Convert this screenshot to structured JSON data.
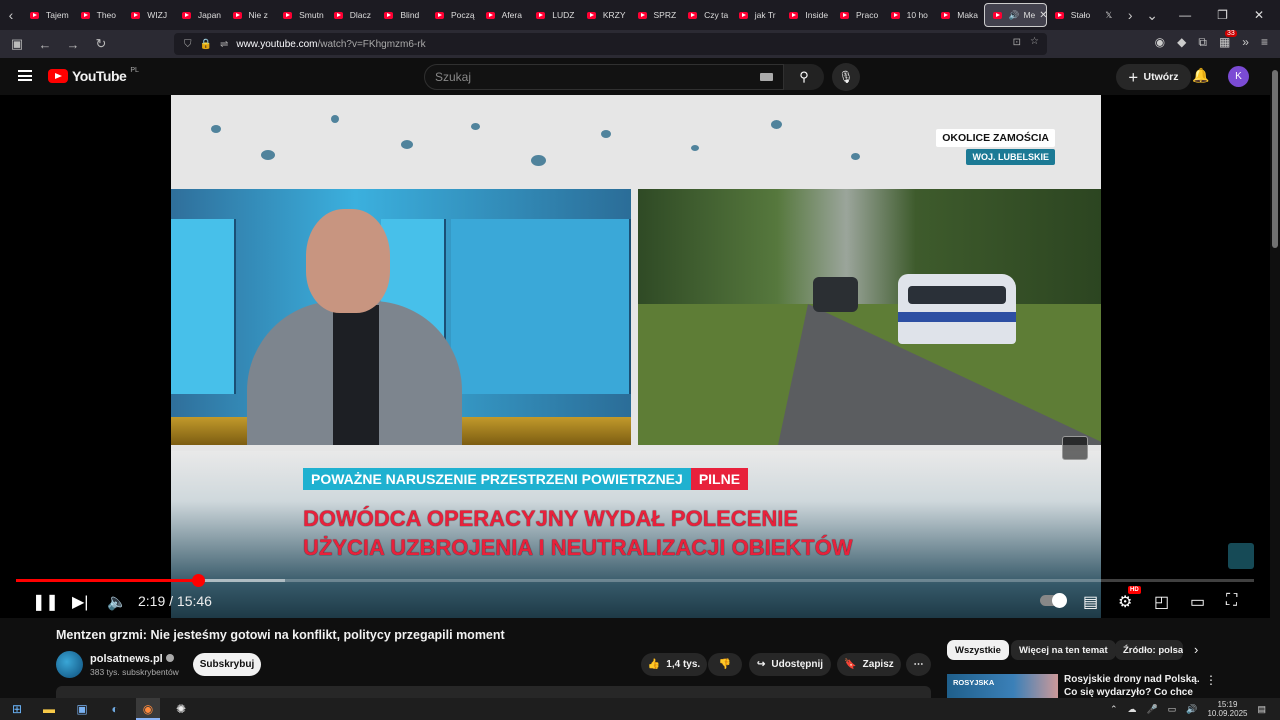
{
  "browser": {
    "tabs": [
      {
        "label": "Tajem"
      },
      {
        "label": "Theo"
      },
      {
        "label": "WIZJ"
      },
      {
        "label": "Japan"
      },
      {
        "label": "Nie z"
      },
      {
        "label": "Smutn"
      },
      {
        "label": "Dlacz"
      },
      {
        "label": "Blind"
      },
      {
        "label": "Począ"
      },
      {
        "label": "Afera"
      },
      {
        "label": "LUDZ"
      },
      {
        "label": "KRZY"
      },
      {
        "label": "SPRZ"
      },
      {
        "label": "Czy ta"
      },
      {
        "label": "jak Tr"
      },
      {
        "label": "Inside"
      },
      {
        "label": "Praco"
      },
      {
        "label": "10 ho"
      },
      {
        "label": "Maka"
      }
    ],
    "active_tab": "Me",
    "after_tab": "Stało",
    "url_domain": "www.youtube.com",
    "url_path": "/watch?v=FKhgmzm6-rk",
    "ext_badge": "33"
  },
  "youtube": {
    "logo_word": "YouTube",
    "logo_region": "PL",
    "search_placeholder": "Szukaj",
    "create_label": "Utwórz",
    "avatar_letter": "K"
  },
  "video": {
    "location_top": "OKOLICE ZAMOŚCIA",
    "location_bottom": "WOJ. LUBELSKIE",
    "banner": "POWAŻNE NARUSZENIE PRZESTRZENI POWIETRZNEJ",
    "banner_tag": "PILNE",
    "headline_line1": "DOWÓDCA OPERACYJNY WYDAŁ POLECENIE",
    "headline_line2": "UŻYCIA UZBROJENIA I NEUTRALIZACJI OBIEKTÓW",
    "time": "2:19 / 15:46",
    "progress_fraction": 0.147,
    "buffered_fraction": 0.217,
    "quality_badge": "HD"
  },
  "details": {
    "title": "Mentzen grzmi: Nie jesteśmy gotowi na konflikt, politycy przegapili moment",
    "channel": "polsatnews.pl",
    "subscribers": "383 tys. subskrybentów",
    "subscribe_label": "Subskrybuj",
    "likes": "1,4 tys.",
    "share_label": "Udostępnij",
    "save_label": "Zapisz"
  },
  "sidebar": {
    "chips": [
      "Wszystkie",
      "Więcej na ten temat",
      "Źródło: polsa"
    ],
    "rec_thumb_label": "ROSYJSKA",
    "rec_title": "Rosyjskie drony nad Polską. Co się wydarzyło? Co chce"
  },
  "taskbar": {
    "time": "15:19",
    "date": "10.09.2025"
  }
}
